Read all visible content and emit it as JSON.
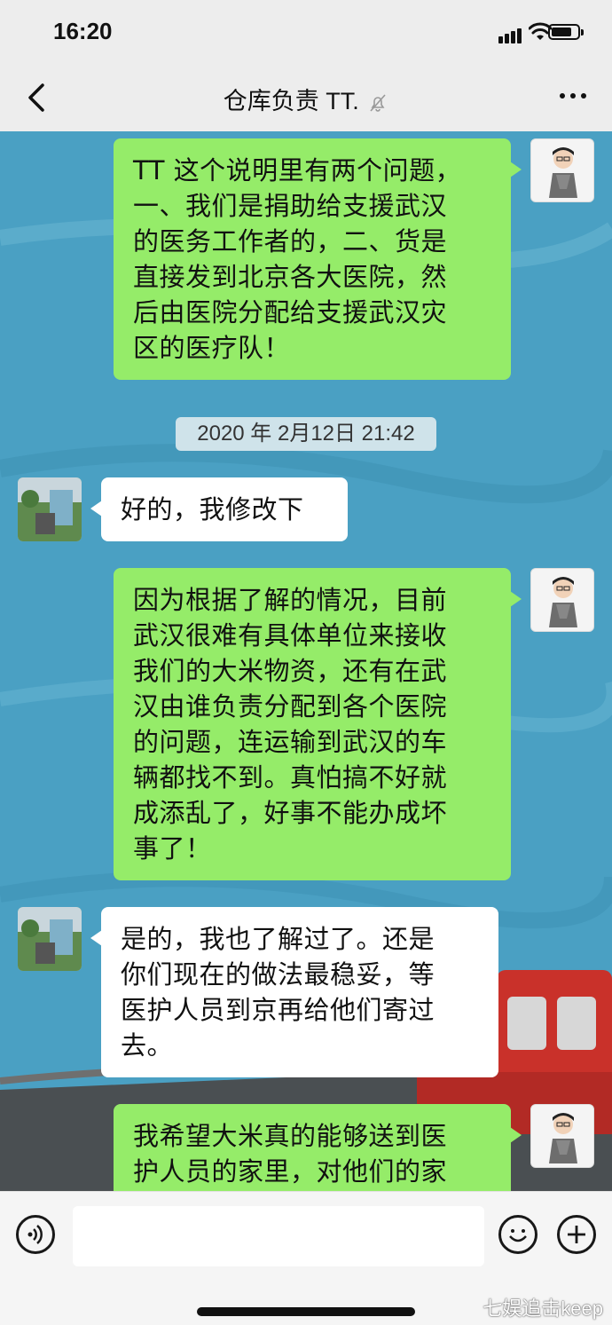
{
  "status": {
    "time": "16:20"
  },
  "nav": {
    "title": "仓库负责 TT."
  },
  "chat": {
    "timestamp": "2020 年 2月12日 21:42",
    "messages": [
      {
        "from": "me",
        "text": "TT 这个说明里有两个问题，\n一、我们是捐助给支援武汉\n的医务工作者的，二、货是\n直接发到北京各大医院，然\n后由医院分配给支援武汉灾\n区的医疗队！"
      },
      {
        "from": "peer",
        "text": "好的，我修改下"
      },
      {
        "from": "me",
        "text": "因为根据了解的情况，目前\n武汉很难有具体单位来接收\n我们的大米物资，还有在武\n汉由谁负责分配到各个医院\n的问题，连运输到武汉的车\n辆都找不到。真怕搞不好就\n成添乱了，好事不能办成坏\n事了！"
      },
      {
        "from": "peer",
        "text": "是的，我也了解过了。还是\n你们现在的做法最稳妥，等\n医护人员到京再给他们寄过\n去。"
      },
      {
        "from": "me",
        "text": "我希望大米真的能够送到医\n护人员的家里，对他们的家"
      }
    ]
  },
  "input": {
    "placeholder": ""
  },
  "watermark": "七娱追击keep",
  "colors": {
    "chat_bg": "#4aa0c3",
    "me_bubble": "#95ec69",
    "peer_bubble": "#ffffff",
    "nav_bg": "#ededed"
  },
  "icons": [
    "chevron-left-icon",
    "mute-bell-icon",
    "more-dots-icon",
    "voice-icon",
    "emoji-icon",
    "plus-icon"
  ]
}
